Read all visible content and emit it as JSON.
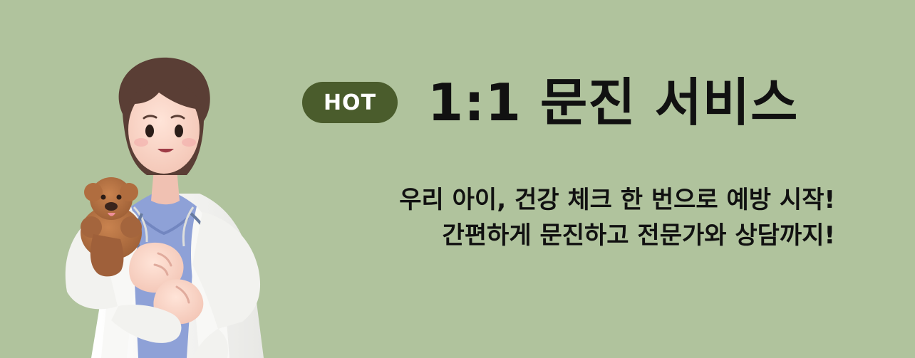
{
  "badge": {
    "label": "HOT",
    "color": "#4a5c2c"
  },
  "headline": {
    "title": "1:1 문진 서비스"
  },
  "subtitle": {
    "line1": "우리 아이, 건강 체크 한 번으로 예방 시작!",
    "line2": "간편하게 문진하고 전문가와 상담까지!"
  },
  "illustration": {
    "icon": "veterinarian-holding-dog-icon"
  },
  "colors": {
    "background": "#b0c39d",
    "text": "#111111",
    "scrub": "#8ea1d7",
    "coat": "#f4f4f2",
    "hair": "#5a3e35",
    "dog": "#b06d3f"
  }
}
